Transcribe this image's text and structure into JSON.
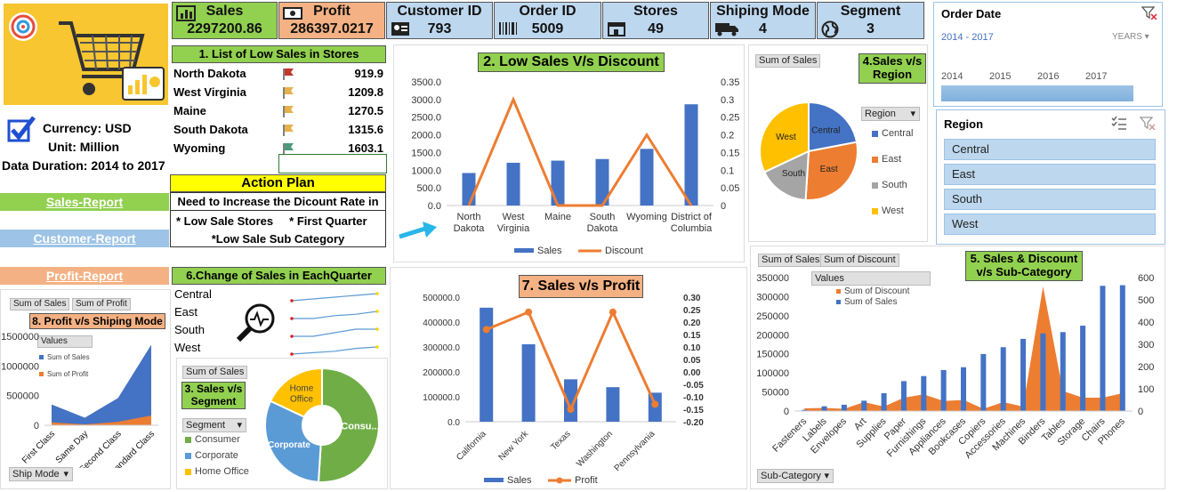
{
  "kpis": [
    {
      "id": "sales",
      "title": "Sales",
      "value": "2297200.86",
      "icon": "bar-chart-icon"
    },
    {
      "id": "profit",
      "title": "Profit",
      "value": "286397.0217",
      "icon": "money-icon"
    },
    {
      "id": "customer",
      "title": "Customer ID",
      "value": "793",
      "icon": "id-card-icon"
    },
    {
      "id": "order",
      "title": "Order ID",
      "value": "5009",
      "icon": "barcode-icon"
    },
    {
      "id": "stores",
      "title": "Stores",
      "value": "49",
      "icon": "store-icon"
    },
    {
      "id": "shipmode",
      "title": "Shiping Mode",
      "value": "4",
      "icon": "truck-icon"
    },
    {
      "id": "segment",
      "title": "Segment",
      "value": "3",
      "icon": "globe-icon"
    }
  ],
  "info": {
    "currency": "Currency: USD",
    "unit": "Unit: Million",
    "duration": "Data Duration: 2014 to 2017"
  },
  "nav": {
    "sales_report": "Sales-Report",
    "customer_report": "Customer-Report",
    "profit_report": "Profit-Report"
  },
  "low_sales": {
    "title": "1. List of Low Sales in Stores",
    "rows": [
      {
        "name": "North Dakota",
        "value": "919.9",
        "flag": "#c0392b"
      },
      {
        "name": "West Virginia",
        "value": "1209.8",
        "flag": "#e6b04a"
      },
      {
        "name": "Maine",
        "value": "1270.5",
        "flag": "#e6b04a"
      },
      {
        "name": "South Dakota",
        "value": "1315.6",
        "flag": "#e6b04a"
      },
      {
        "name": "Wyoming",
        "value": "1603.1",
        "flag": "#4a9a7a"
      }
    ]
  },
  "action_plan": {
    "title": "Action Plan",
    "line1": "Need to Increase the Dicount Rate in",
    "line2": "* Low Sale Stores     * First Quarter",
    "line3": "*Low Sale Sub Category"
  },
  "quarter": {
    "title": "6.Change of Sales in EachQuarter",
    "regions": [
      "Central",
      "East",
      "South",
      "West"
    ]
  },
  "pivot_pills": {
    "sum_sales": "Sum of Sales",
    "sum_profit": "Sum of Profit",
    "sum_discount": "Sum of Discount",
    "values": "Values",
    "region": "Region",
    "segment": "Segment",
    "sub_category": "Sub-Category",
    "ship_mode": "Ship Mode"
  },
  "slicer_date": {
    "title": "Order Date",
    "range": "2014 - 2017",
    "level": "YEARS",
    "years": [
      "2014",
      "2015",
      "2016",
      "2017"
    ]
  },
  "slicer_region": {
    "title": "Region",
    "items": [
      "Central",
      "East",
      "South",
      "West"
    ]
  },
  "colors": {
    "blue": "#4472c4",
    "orange": "#ed7d31",
    "gray": "#a5a5a5",
    "yellow": "#ffc000",
    "green": "#70ad47",
    "lightblue": "#5b9bd5"
  },
  "chart_data": [
    {
      "id": "low-sales-discount",
      "type": "bar",
      "title": "2. Low Sales V/s Discount",
      "categories": [
        "North Dakota",
        "West Virginia",
        "Maine",
        "South Dakota",
        "Wyoming",
        "District of Columbia"
      ],
      "series": [
        {
          "name": "Sales",
          "type": "bar",
          "values": [
            920,
            1210,
            1270,
            1316,
            1603,
            2865
          ]
        },
        {
          "name": "Discount",
          "type": "line",
          "axis": "right",
          "values": [
            0,
            0.3,
            0,
            0,
            0.2,
            0
          ]
        }
      ],
      "ylim": [
        0,
        3500
      ],
      "y2lim": [
        0,
        0.35
      ],
      "yticks": [
        "0.0",
        "500.0",
        "1000.0",
        "1500.0",
        "2000.0",
        "2500.0",
        "3000.0",
        "3500.0"
      ],
      "y2ticks": [
        "0",
        "0.05",
        "0.1",
        "0.15",
        "0.2",
        "0.25",
        "0.3",
        "0.35"
      ]
    },
    {
      "id": "sales-region",
      "type": "pie",
      "title": "4.Sales v/s Region",
      "categories": [
        "Central",
        "East",
        "South",
        "West"
      ],
      "values": [
        22,
        29,
        17,
        32
      ],
      "legend": "right"
    },
    {
      "id": "sales-profit",
      "type": "bar",
      "title": "7. Sales v/s Profit",
      "categories": [
        "California",
        "New York",
        "Texas",
        "Washington",
        "Pennsylvania"
      ],
      "series": [
        {
          "name": "Sales",
          "type": "bar",
          "values": [
            457688,
            310876,
            170188,
            138641,
            116512
          ]
        },
        {
          "name": "Profit",
          "type": "line",
          "axis": "right",
          "values": [
            0.17,
            0.24,
            -0.15,
            0.24,
            -0.13
          ]
        }
      ],
      "ylim": [
        0,
        500000
      ],
      "y2lim": [
        -0.2,
        0.3
      ],
      "yticks": [
        "0.0",
        "100000.0",
        "200000.0",
        "300000.0",
        "400000.0",
        "500000.0"
      ],
      "y2ticks": [
        "-0.20",
        "-0.15",
        "-0.10",
        "-0.05",
        "0.00",
        "0.05",
        "0.10",
        "0.15",
        "0.20",
        "0.25",
        "0.30"
      ]
    },
    {
      "id": "sales-discount-subcat",
      "type": "bar",
      "title": "5. Sales & Discount v/s Sub-Category",
      "categories": [
        "Fasteners",
        "Labels",
        "Envelopes",
        "Art",
        "Supplies",
        "Paper",
        "Furnishings",
        "Appliances",
        "Bookcases",
        "Copiers",
        "Accessories",
        "Machines",
        "Binders",
        "Tables",
        "Storage",
        "Chairs",
        "Phones"
      ],
      "series": [
        {
          "name": "Sum of Sales",
          "type": "bar",
          "values": [
            3024,
            12486,
            16476,
            27119,
            46674,
            78479,
            91705,
            107532,
            114880,
            149528,
            167380,
            189239,
            203413,
            206966,
            223844,
            328449,
            330007
          ]
        },
        {
          "name": "Sum of Discount",
          "type": "area",
          "axis": "right",
          "values": [
            12,
            14,
            10,
            40,
            20,
            60,
            75,
            45,
            50,
            10,
            40,
            20,
            560,
            90,
            60,
            60,
            80
          ]
        }
      ],
      "ylim": [
        0,
        350000
      ],
      "y2lim": [
        0,
        600
      ],
      "yticks": [
        "0",
        "50000",
        "100000",
        "150000",
        "200000",
        "250000",
        "300000",
        "350000"
      ],
      "y2ticks": [
        "0",
        "100",
        "200",
        "300",
        "400",
        "500",
        "600"
      ]
    },
    {
      "id": "profit-shipmode",
      "type": "area",
      "title": "8. Profit v/s Shiping Mode",
      "categories": [
        "First Class",
        "Same Day",
        "Second Class",
        "Standard Class"
      ],
      "series": [
        {
          "name": "Sum of Sales",
          "values": [
            351428,
            128363,
            459194,
            1358216
          ]
        },
        {
          "name": "Sum of Profit",
          "values": [
            48970,
            15892,
            57447,
            164089
          ]
        }
      ],
      "ylim": [
        0,
        1500000
      ],
      "yticks": [
        "0",
        "500000",
        "1000000",
        "1500000"
      ]
    },
    {
      "id": "sales-segment",
      "type": "pie",
      "title": "3. Sales v/s Segment",
      "categories": [
        "Consumer",
        "Corporate",
        "Home Office"
      ],
      "values": [
        51,
        31,
        18
      ],
      "labels": [
        "Consu...",
        "Corporate",
        "Home Office"
      ]
    },
    {
      "id": "quarter-sparklines",
      "type": "line",
      "series": [
        {
          "name": "Central",
          "values": [
            3,
            4,
            5,
            6,
            7
          ]
        },
        {
          "name": "East",
          "values": [
            3,
            3,
            5,
            6,
            8
          ]
        },
        {
          "name": "South",
          "values": [
            4,
            4,
            5,
            6,
            6
          ]
        },
        {
          "name": "West",
          "values": [
            3,
            4,
            5,
            7,
            8
          ]
        }
      ]
    }
  ]
}
